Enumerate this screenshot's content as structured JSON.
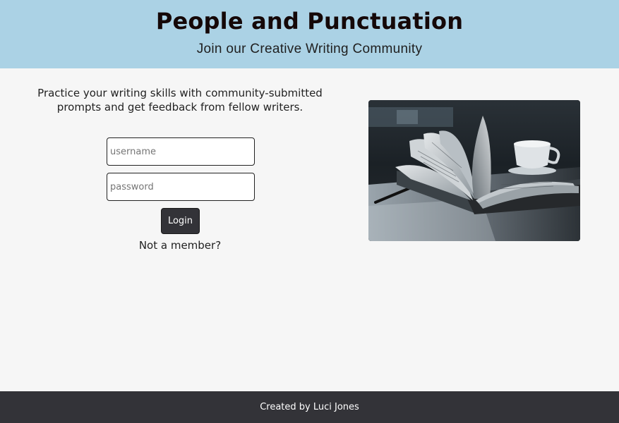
{
  "header": {
    "title": "People and Punctuation",
    "subtitle": "Join our Creative Writing Community"
  },
  "main": {
    "intro": "Practice your writing skills with community-submitted prompts and get feedback from fellow writers.",
    "login_form": {
      "username_placeholder": "username",
      "password_placeholder": "password",
      "username_value": "",
      "password_value": "",
      "login_label": "Login",
      "signup_link": "Not a member?"
    }
  },
  "footer": {
    "credit": "Created by Luci Jones"
  },
  "colors": {
    "header_bg": "#abd2e5",
    "page_bg": "#f6f6f6",
    "footer_bg": "#333338",
    "button_bg": "#333338"
  }
}
